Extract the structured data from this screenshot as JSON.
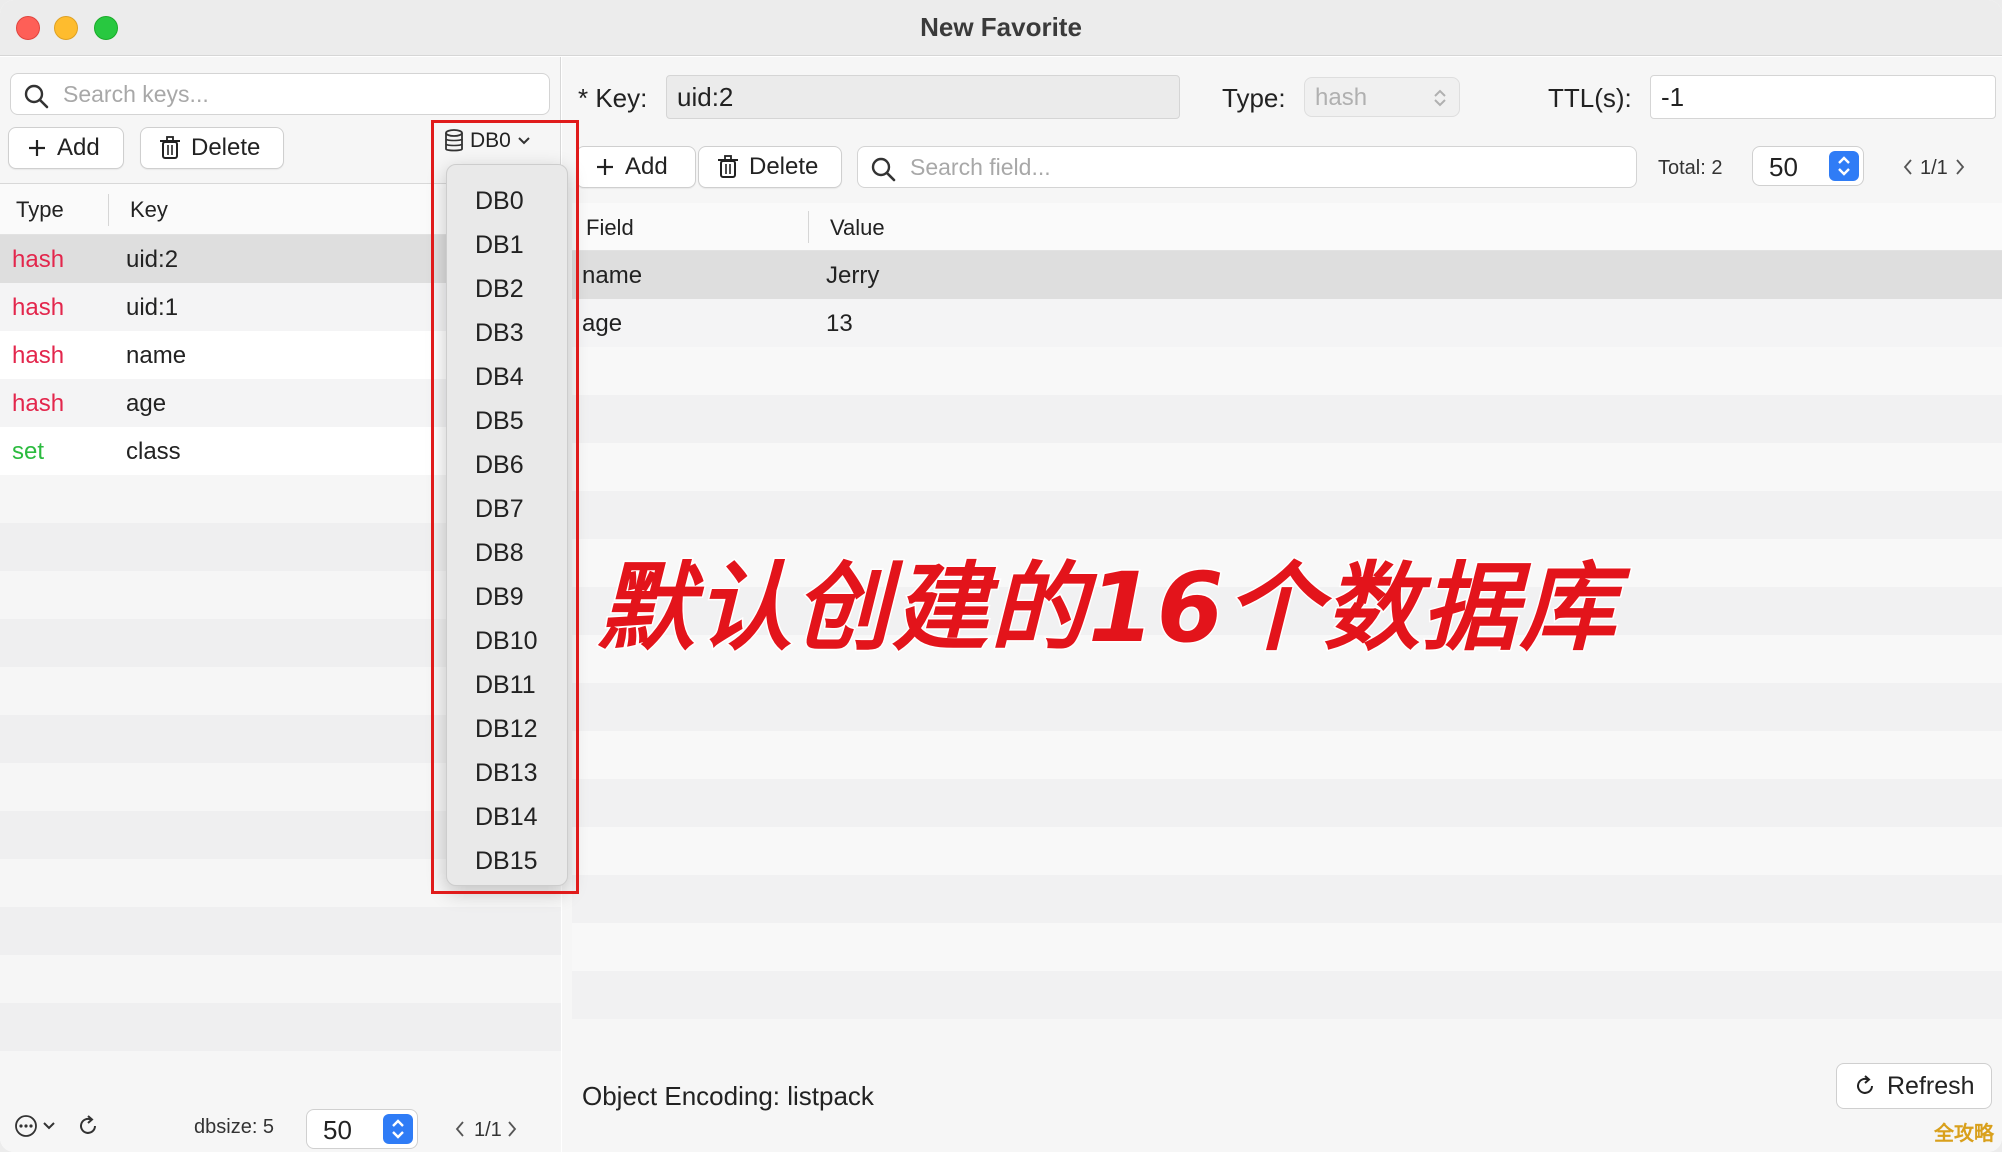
{
  "window": {
    "title": "New Favorite"
  },
  "left": {
    "search": {
      "placeholder": "Search keys..."
    },
    "add_label": "Add",
    "delete_label": "Delete",
    "db_selected": "DB0",
    "columns": {
      "type": "Type",
      "key": "Key"
    },
    "rows": [
      {
        "type": "hash",
        "key": "uid:2",
        "type_color": "#e3264c"
      },
      {
        "type": "hash",
        "key": "uid:1",
        "type_color": "#e3264c"
      },
      {
        "type": "hash",
        "key": "name",
        "type_color": "#e3264c"
      },
      {
        "type": "hash",
        "key": "age",
        "type_color": "#e3264c"
      },
      {
        "type": "set",
        "key": "class",
        "type_color": "#2bbb3f"
      }
    ],
    "footer": {
      "dbsize": "dbsize: 5",
      "page_size": "50",
      "page": "1/1"
    }
  },
  "db_menu": [
    "DB0",
    "DB1",
    "DB2",
    "DB3",
    "DB4",
    "DB5",
    "DB6",
    "DB7",
    "DB8",
    "DB9",
    "DB10",
    "DB11",
    "DB12",
    "DB13",
    "DB14",
    "DB15"
  ],
  "right": {
    "key_label": "* Key:",
    "key_value": "uid:2",
    "type_label": "Type:",
    "type_value": "hash",
    "ttl_label": "TTL(s):",
    "ttl_value": "-1",
    "add_label": "Add",
    "delete_label": "Delete",
    "search": {
      "placeholder": "Search field..."
    },
    "total": "Total: 2",
    "page_size": "50",
    "page": "1/1",
    "columns": {
      "field": "Field",
      "value": "Value"
    },
    "rows": [
      {
        "field": "name",
        "value": "Jerry"
      },
      {
        "field": "age",
        "value": "13"
      }
    ],
    "encoding": "Object Encoding: listpack",
    "refresh_label": "Refresh"
  },
  "annotation": "默认创建的16个数据库",
  "watermark": "全攻略"
}
